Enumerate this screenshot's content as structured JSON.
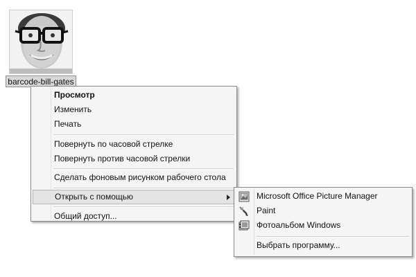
{
  "desktop": {
    "file": {
      "label": "barcode-bill-gates",
      "thumbnail_icon": "photo-thumbnail"
    }
  },
  "context_menu": {
    "items": [
      {
        "label": "Просмотр",
        "bold": true
      },
      {
        "label": "Изменить"
      },
      {
        "label": "Печать"
      },
      {
        "label": "Повернуть по часовой стрелке"
      },
      {
        "label": "Повернуть против часовой стрелки"
      },
      {
        "label": "Сделать фоновым рисунком рабочего стола"
      },
      {
        "label": "Открыть с помощью",
        "has_submenu": true,
        "highlighted": true
      },
      {
        "label": "Общий доступ..."
      }
    ]
  },
  "open_with_submenu": {
    "items": [
      {
        "label": "Microsoft Office Picture Manager",
        "icon": "picture-manager-icon"
      },
      {
        "label": "Paint",
        "icon": "paint-icon"
      },
      {
        "label": "Фотоальбом Windows",
        "icon": "photo-gallery-icon"
      },
      {
        "label": "Выбрать программу..."
      }
    ]
  }
}
